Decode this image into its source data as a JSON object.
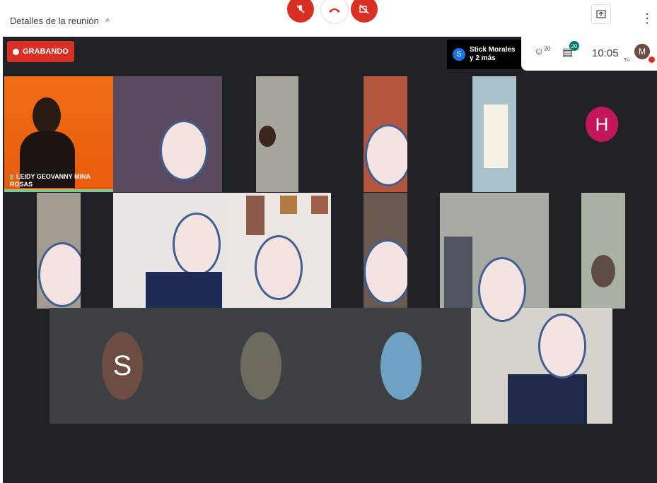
{
  "topbar": {
    "details_label": "Detalles de la reunión",
    "details_chevron": "^"
  },
  "controls": {
    "mic_icon": "mic-off-icon",
    "hang_icon": "call-end-icon",
    "cam_icon": "videocam-off-icon",
    "present_icon": "present-icon",
    "more_icon": "more-vert-icon",
    "more_glyph": "⋮"
  },
  "recording": {
    "label": "GRABANDO"
  },
  "presenter": {
    "badge": "S",
    "line1": "Stick Morales",
    "line2": "y 2 más"
  },
  "info": {
    "people_count": "20",
    "chat_count": "20",
    "time": "10:05",
    "you_label": "Tú",
    "avatar_letter": "M"
  },
  "participants": {
    "speaker_name": "LEIDY GEOVANNY MINA ROSAS",
    "avatar_h": "H",
    "avatar_s": "S"
  },
  "colors": {
    "stage_bg": "#202124",
    "record_red": "#d93025",
    "speaker_green": "#81c995",
    "avatar_h": "#c2185b",
    "avatar_s": "#6d4c41"
  }
}
